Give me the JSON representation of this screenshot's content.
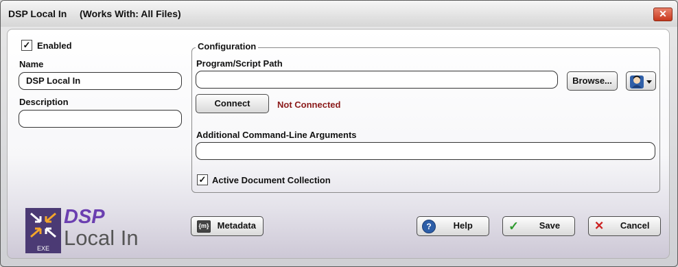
{
  "window": {
    "title": "DSP Local In",
    "subtitle": "(Works With: All Files)",
    "close_glyph": "✕"
  },
  "left": {
    "enabled_label": "Enabled",
    "enabled_checked": true,
    "name_label": "Name",
    "name_value": "DSP Local In",
    "description_label": "Description",
    "description_value": ""
  },
  "config": {
    "group_title": "Configuration",
    "program_path_label": "Program/Script Path",
    "program_path_value": "",
    "browse_label": "Browse...",
    "connect_label": "Connect",
    "connection_status": "Not Connected",
    "args_label": "Additional Command-Line Arguments",
    "args_value": "",
    "active_doc_label": "Active Document Collection",
    "active_doc_checked": true
  },
  "footer": {
    "logo_title": "DSP",
    "logo_subtitle": "Local In",
    "logo_badge": "EXE",
    "metadata_label": "Metadata",
    "help_label": "Help",
    "save_label": "Save",
    "cancel_label": "Cancel"
  },
  "icons": {
    "check": "✓",
    "close_x": "✕"
  },
  "colors": {
    "status_red": "#8b1a1a",
    "logo_purple": "#6b3fb0",
    "close_red": "#c7381d"
  }
}
